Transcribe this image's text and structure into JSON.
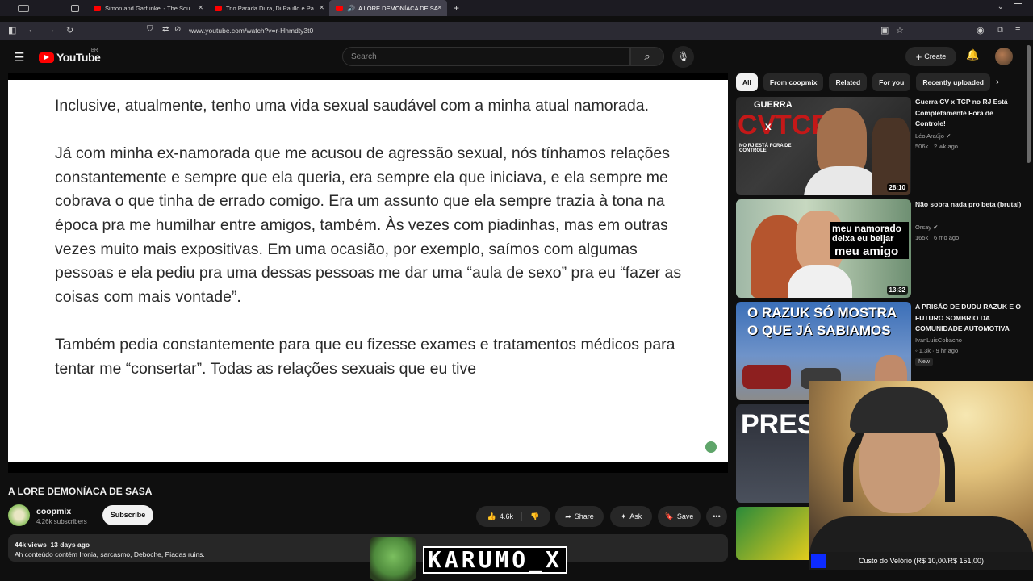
{
  "browser": {
    "tabs": [
      {
        "label": ""
      },
      {
        "label": "Simon and Garfunkel - The Sou"
      },
      {
        "label": "Trio Parada Dura, Di Paullo e Pa"
      },
      {
        "label": "A LORE DEMONÍACA DE SA"
      }
    ],
    "url": "www.youtube.com/watch?v=r-Hhmdty3t0"
  },
  "header": {
    "logo": "YouTube",
    "country": "BR",
    "search_placeholder": "Search",
    "create_label": "Create"
  },
  "slide": {
    "paragraphs": [
      "Inclusive, atualmente, tenho uma vida sexual saudável com a minha atual namorada.",
      "Já com minha ex-namorada que me acusou de agressão sexual, nós tínhamos relações constantemente e sempre que ela queria, era sempre ela que iniciava, e ela sempre me cobrava o que tinha de errado comigo. Era um assunto que ela sempre trazia à tona na época pra me humilhar entre amigos, também. Às vezes com piadinhas, mas em outras vezes muito mais expositivas. Em uma ocasião, por exemplo, saímos com algumas pessoas e ela pediu pra uma dessas pessoas me dar uma “aula de sexo” pra eu “fazer as coisas com mais vontade”.",
      "Também pedia constantemente para que eu fizesse exames e tratamentos médicos para tentar me “consertar”. Todas as relações sexuais que eu tive"
    ]
  },
  "video": {
    "title": "A LORE DEMONÍACA DE SASA",
    "channel": "coopmix",
    "subscribers": "4.26k subscribers",
    "subscribe_label": "Subscribe",
    "likes": "4.6k",
    "share_label": "Share",
    "ask_label": "Ask",
    "save_label": "Save",
    "views": "44k views",
    "posted": "13 days ago",
    "description": "Ah conteúdo contém Ironia, sarcasmo, Deboche, Piadas ruins."
  },
  "chips": [
    "All",
    "From coopmix",
    "Related",
    "For you",
    "Recently uploaded"
  ],
  "recommendations": [
    {
      "title": "Guerra CV x TCP no RJ Está Completamente Fora de Controle!",
      "channel": "Léo Araújo",
      "views": "506k",
      "age": "2 wk ago",
      "duration": "28:10",
      "thumb_text": [
        "GUERRA",
        "CV",
        "x",
        "TCP",
        "NO RJ ESTÁ FORA DE CONTROLE"
      ]
    },
    {
      "title": "Não sobra nada pro beta (brutal)",
      "channel": "Orsay",
      "views": "165k",
      "age": "6 mo ago",
      "duration": "13:32",
      "thumb_text": [
        "meu namorado",
        "deixa eu beijar",
        "meu amigo"
      ]
    },
    {
      "title": "A PRISÃO DE DUDU RAZUK E O FUTURO SOMBRIO DA COMUNIDADE AUTOMOTIVA",
      "channel": "IvanLuisCobacho",
      "views": "1.3k",
      "age": "9 hr ago",
      "badge": "New",
      "thumb_text": [
        "O RAZUK SÓ MOSTRA",
        "O QUE JÁ SABIAMOS"
      ]
    },
    {
      "thumb_text": [
        "PRES"
      ]
    }
  ],
  "overlay": {
    "banner": "KARUMO_X",
    "donation": "Custo do Velório (R$ 10,00/R$ 151,00)"
  },
  "colors": {
    "accent": "#ff0000",
    "bg": "#0f0f0f",
    "surface": "#272727",
    "donation_bar": "#0d2bff"
  }
}
